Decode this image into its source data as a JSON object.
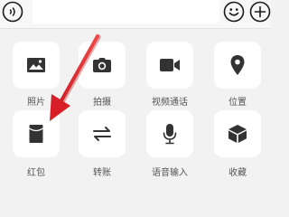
{
  "input_bar": {
    "text_value": "",
    "voice_icon": "voice-icon",
    "emoji_icon": "emoji-icon",
    "plus_icon": "plus-icon"
  },
  "panel": {
    "items": [
      {
        "label": "照片",
        "icon": "photo-icon"
      },
      {
        "label": "拍摄",
        "icon": "camera-icon"
      },
      {
        "label": "视频通话",
        "icon": "video-call-icon"
      },
      {
        "label": "位置",
        "icon": "location-icon"
      },
      {
        "label": "红包",
        "icon": "red-packet-icon"
      },
      {
        "label": "转账",
        "icon": "transfer-icon"
      },
      {
        "label": "语音输入",
        "icon": "microphone-icon"
      },
      {
        "label": "收藏",
        "icon": "favorites-icon"
      }
    ]
  },
  "annotation": {
    "arrow_color": "#e8232b",
    "target": "红包"
  }
}
